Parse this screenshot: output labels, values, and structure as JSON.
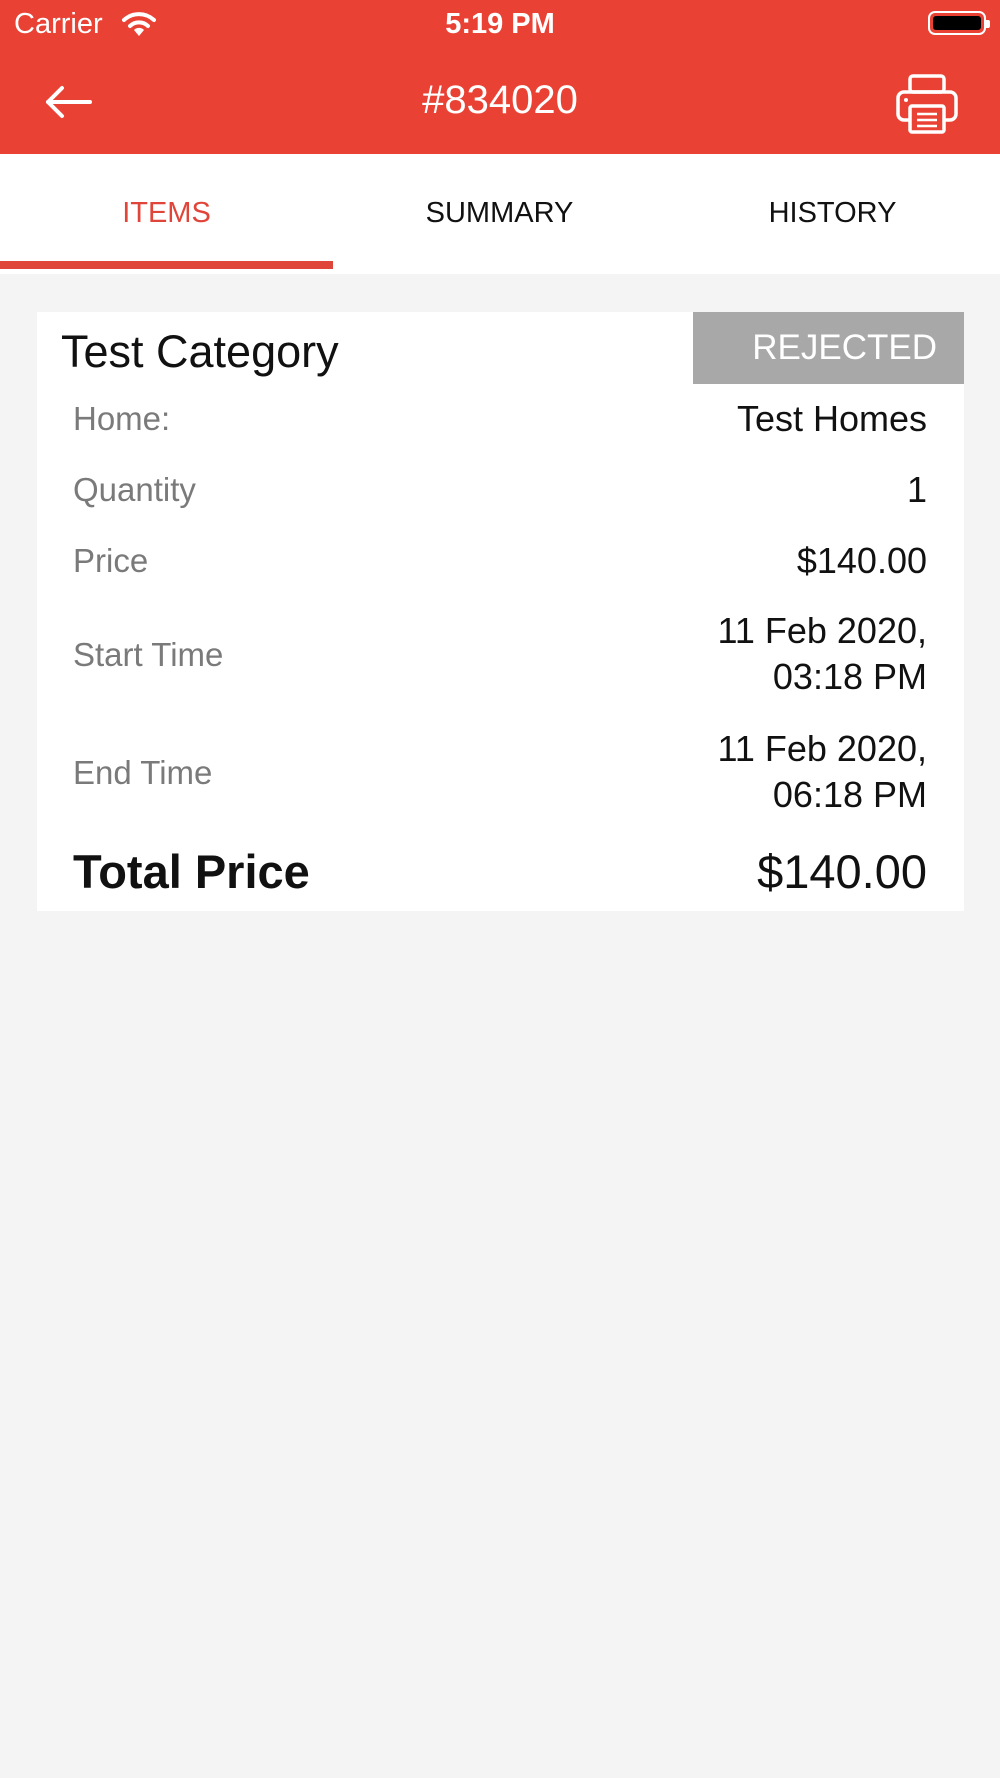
{
  "status_bar": {
    "carrier": "Carrier",
    "time": "5:19 PM"
  },
  "nav": {
    "title": "#834020",
    "back_icon": "arrow-left-icon",
    "print_icon": "printer-icon"
  },
  "tabs": [
    {
      "label": "ITEMS",
      "active": true
    },
    {
      "label": "SUMMARY",
      "active": false
    },
    {
      "label": "HISTORY",
      "active": false
    }
  ],
  "item": {
    "category": "Test Category",
    "status": "REJECTED",
    "rows": [
      {
        "label": "Home:",
        "value": "Test Homes"
      },
      {
        "label": "Quantity",
        "value": "1"
      },
      {
        "label": "Price",
        "value": "$140.00"
      },
      {
        "label": "Start Time",
        "value_line1": "11 Feb 2020,",
        "value_line2": "03:18 PM"
      },
      {
        "label": "End Time",
        "value_line1": "11 Feb 2020,",
        "value_line2": "06:18 PM"
      }
    ],
    "total_label": "Total Price",
    "total_value": "$140.00"
  },
  "colors": {
    "accent": "#e94235",
    "status_badge": "#a8a8a8",
    "background": "#f4f4f4"
  }
}
